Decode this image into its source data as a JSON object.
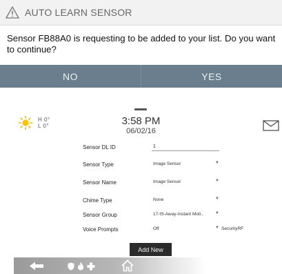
{
  "dialog": {
    "title": "AUTO LEARN SENSOR",
    "message": "Sensor FB88A0 is requesting to be added to your list. Do you want to continue?",
    "no_label": "NO",
    "yes_label": "YES",
    "warning_icon": "warning-triangle-icon",
    "colors": {
      "button_bar": "#6a7e8d",
      "header_bg": "#f2f2f2"
    }
  },
  "status": {
    "weather_icon": "sun-icon",
    "temp_high": "H 0°",
    "temp_low": "L 0°",
    "time": "3:58 PM",
    "date": "06/02/16",
    "mail_icon": "envelope-icon"
  },
  "form": {
    "sensor_dl_id": {
      "label": "Sensor DL ID",
      "value": "1"
    },
    "sensor_type": {
      "label": "Sensor Type",
      "value": "Image Sensor"
    },
    "sensor_name": {
      "label": "Sensor Name",
      "value": "Image Sensor"
    },
    "chime_type": {
      "label": "Chime Type",
      "value": "None"
    },
    "sensor_group": {
      "label": "Sensor Group",
      "value": "17-IS-Away-Instant Moti.."
    },
    "voice_prompts": {
      "label": "Voice Prompts",
      "value": "Off",
      "extra": "SecurityRF"
    },
    "add_new_label": "Add New"
  },
  "bottom_bar": {
    "icons": [
      "back-arrow-icon",
      "shield-icon",
      "fire-icon",
      "medical-cross-icon",
      "home-icon"
    ]
  }
}
